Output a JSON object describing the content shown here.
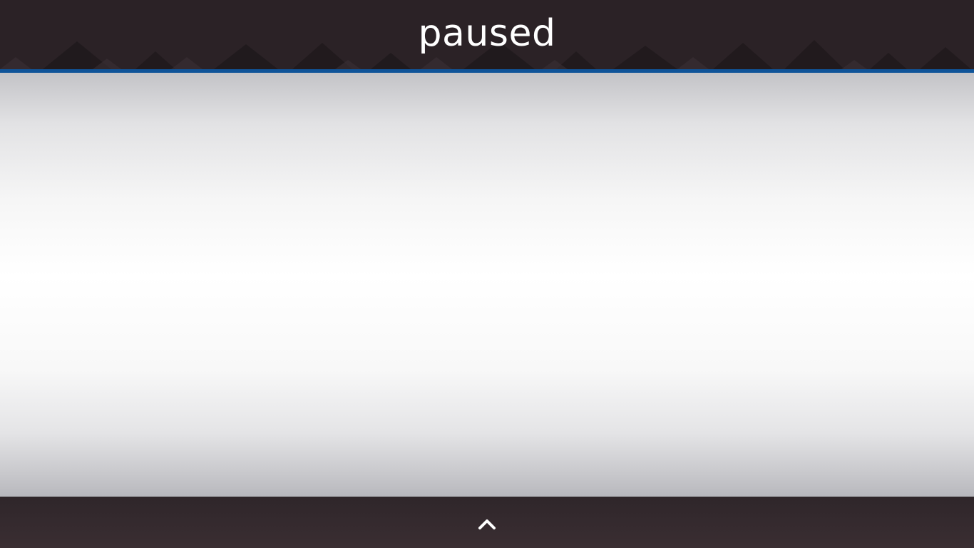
{
  "header": {
    "title": "paused"
  },
  "footer": {
    "expand_icon": "chevron-up-icon"
  },
  "colors": {
    "header_bg": "#2b2226",
    "accent": "#0f5499",
    "footer_bg": "#3a2e32",
    "title_text": "#ffffff"
  }
}
